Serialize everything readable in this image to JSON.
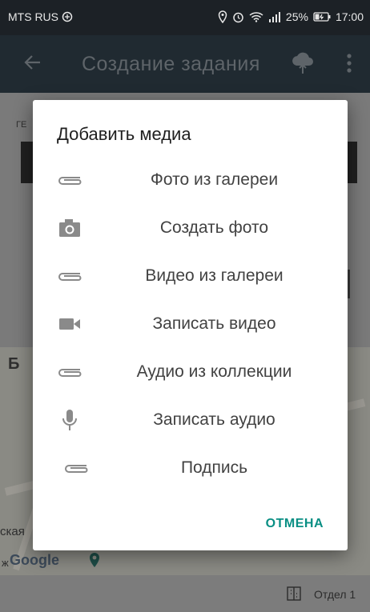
{
  "status_bar": {
    "carrier": "MTS RUS",
    "battery": "25%",
    "time": "17:00"
  },
  "app_bar": {
    "title": "Создание задания"
  },
  "background": {
    "section_letter": "Б",
    "field_label_fragment": "ГЕ",
    "map_text": "ская",
    "map_text_2": "ж",
    "map_brand": "Google",
    "bottom_right_label": "Отдел 1"
  },
  "dialog": {
    "title": "Добавить медиа",
    "items": [
      {
        "icon": "paperclip-icon",
        "label": "Фото из галереи"
      },
      {
        "icon": "camera-icon",
        "label": "Создать фото"
      },
      {
        "icon": "paperclip-icon",
        "label": "Видео из галереи"
      },
      {
        "icon": "videocam-icon",
        "label": "Записать видео"
      },
      {
        "icon": "paperclip-icon",
        "label": "Аудио из коллекции"
      },
      {
        "icon": "microphone-icon",
        "label": "Записать аудио"
      },
      {
        "icon": "paperclip-icon",
        "label": "Подпись"
      }
    ],
    "cancel_label": "ОТМЕНА"
  },
  "colors": {
    "accent": "#0a8f84",
    "app_bar": "#202a31",
    "status_bar": "#1c2126"
  }
}
